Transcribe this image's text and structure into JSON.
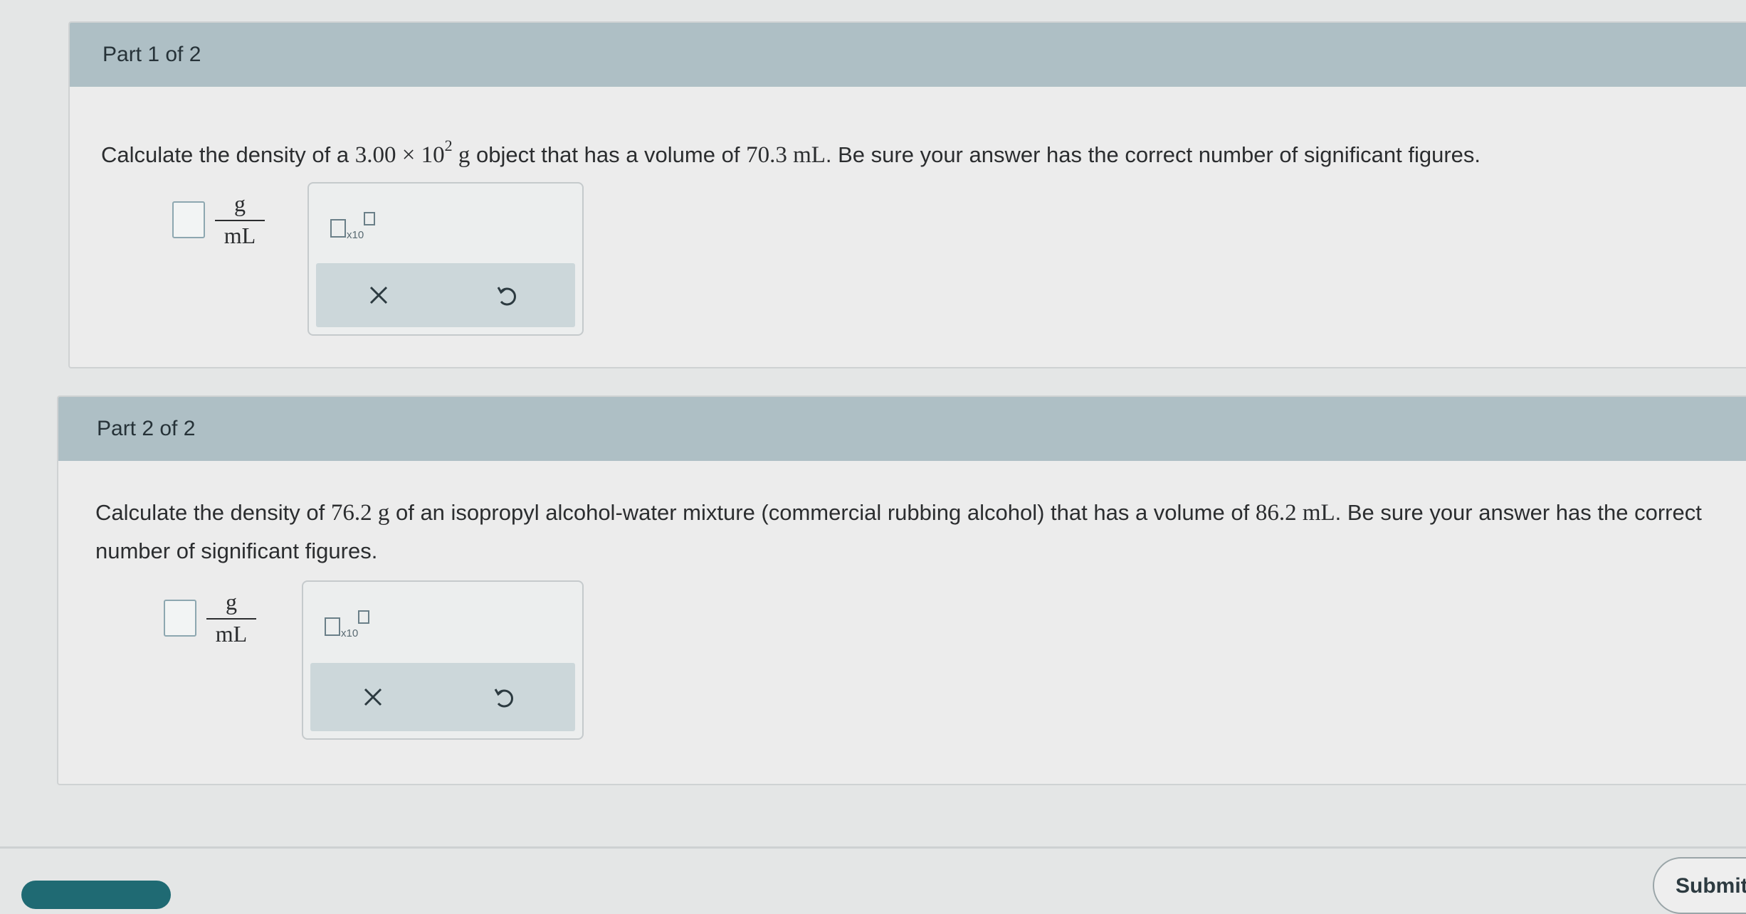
{
  "part1": {
    "header": "Part 1 of 2",
    "prompt_before": "Calculate the density of a ",
    "mass_mantissa": "3.00",
    "times": " × ",
    "mass_base": "10",
    "mass_exp": "2",
    "mass_unit": " g",
    "prompt_after": " object that has a volume of ",
    "volume": "70.3 mL",
    "prompt_end": ". Be sure your answer has the correct number of significant figures.",
    "unit_num": "g",
    "unit_den": "mL",
    "answer_value": ""
  },
  "part2": {
    "header": "Part 2 of 2",
    "prompt_start": "Calculate the density of ",
    "mass": "76.2 g",
    "prompt_mid": " of an isopropyl alcohol-water mixture (commercial rubbing alcohol) that has a volume of ",
    "volume": "86.2 mL",
    "prompt_end": ". Be sure your answer has the correct number of significant figures.",
    "unit_num": "g",
    "unit_den": "mL",
    "answer_value": ""
  },
  "tools": {
    "x10_label": "x10",
    "clear_icon": "close-icon",
    "undo_icon": "undo-icon"
  },
  "footer": {
    "submit_label": "Submit"
  },
  "colors": {
    "header_bg": "#aebfc5",
    "card_bg": "#ececec",
    "toolbar_bg": "#ccd7da",
    "accent": "#1f6a73"
  }
}
